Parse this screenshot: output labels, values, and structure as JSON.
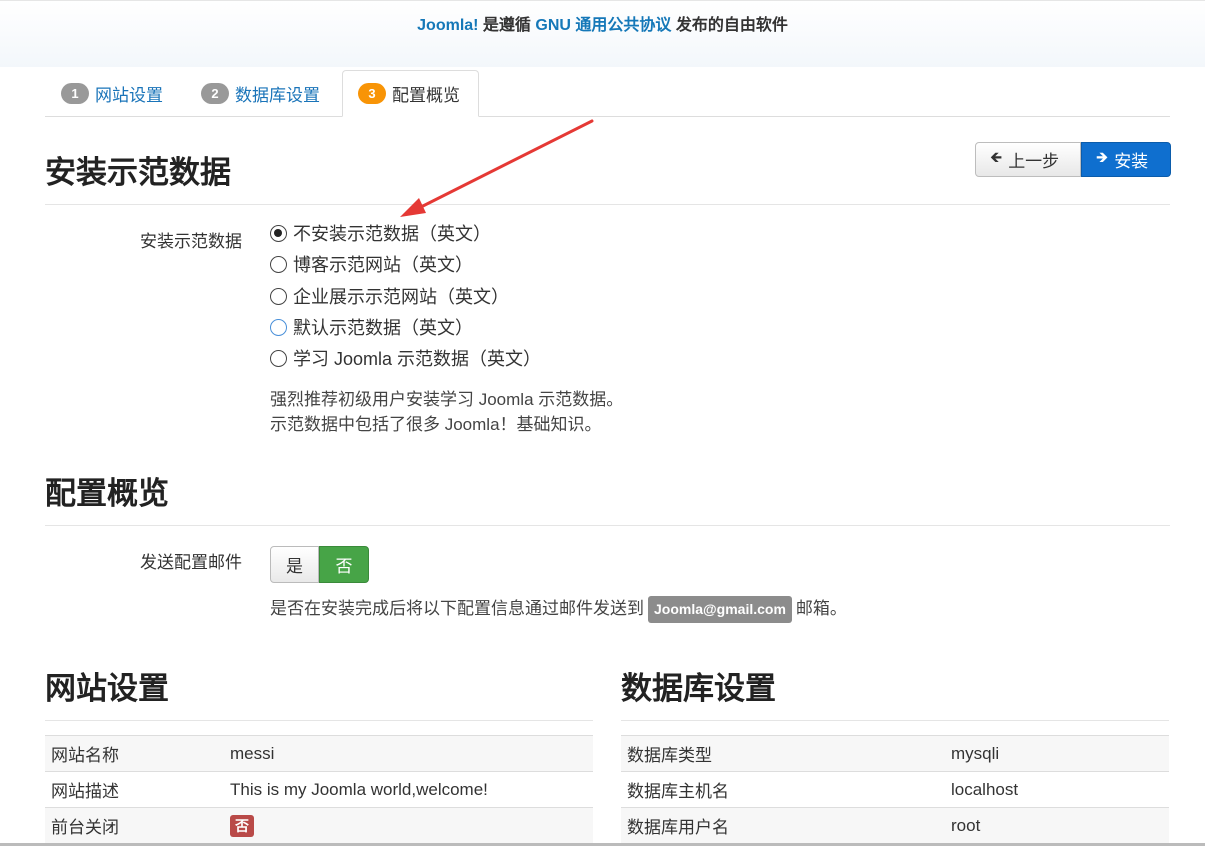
{
  "header": {
    "joomla": "Joomla!",
    "text1": " 是遵循 ",
    "gnu_link": "GNU 通用公共协议",
    "text2": " 发布的自由软件"
  },
  "tabs": [
    {
      "num": "1",
      "label": "网站设置"
    },
    {
      "num": "2",
      "label": "数据库设置"
    },
    {
      "num": "3",
      "label": "配置概览"
    }
  ],
  "sample": {
    "title": "安装示范数据",
    "field_label": "安装示范数据",
    "options": [
      "不安装示范数据（英文）",
      "博客示范网站（英文）",
      "企业展示示范网站（英文）",
      "默认示范数据（英文）",
      "学习 Joomla 示范数据（英文）"
    ],
    "selected_index": 0,
    "help_line1": "强烈推荐初级用户安装学习 Joomla 示范数据。",
    "help_line2": "示范数据中包括了很多 Joomla！基础知识。"
  },
  "buttons": {
    "prev": "上一步",
    "install": "安装"
  },
  "overview": {
    "title": "配置概览",
    "email_label": "发送配置邮件",
    "yes": "是",
    "no": "否",
    "selected": "否",
    "help_before": "是否在安装完成后将以下配置信息通过邮件发送到",
    "email": "Joomla@gmail.com",
    "help_after": "邮箱。"
  },
  "site_settings": {
    "title": "网站设置",
    "rows": [
      {
        "key": "网站名称",
        "value": "messi"
      },
      {
        "key": "网站描述",
        "value": "This is my Joomla world,welcome!"
      },
      {
        "key": "前台关闭",
        "value": "否"
      }
    ]
  },
  "db_settings": {
    "title": "数据库设置",
    "rows": [
      {
        "key": "数据库类型",
        "value": "mysqli"
      },
      {
        "key": "数据库主机名",
        "value": "localhost"
      },
      {
        "key": "数据库用户名",
        "value": "root"
      }
    ]
  },
  "colors": {
    "accent": "#0f6fcf",
    "link": "#1a74b9",
    "success": "#47a447",
    "danger": "#b94a48",
    "annotation_arrow": "#e53935"
  }
}
